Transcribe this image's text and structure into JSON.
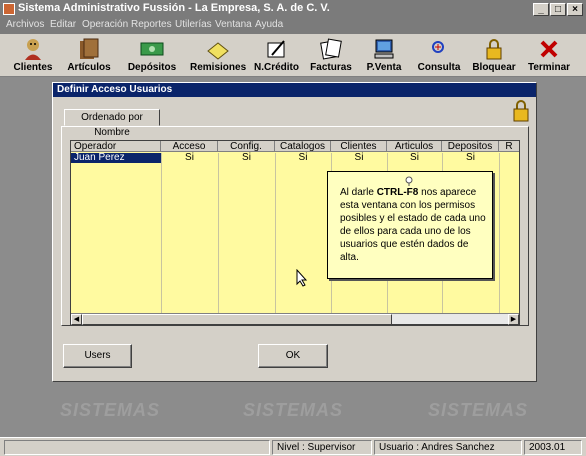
{
  "window": {
    "title": "Sistema Administrativo Fussión - La Empresa, S. A. de C. V."
  },
  "menu": [
    "Archivos",
    "Editar",
    "Operación",
    "Reportes",
    "Utilerías",
    "Ventana",
    "Ayuda"
  ],
  "toolbar": [
    {
      "label": "Clientes",
      "icon": "person-icon"
    },
    {
      "label": "Artículos",
      "icon": "folders-icon"
    },
    {
      "label": "Depósitos",
      "icon": "money-icon"
    },
    {
      "label": "Remisiones",
      "icon": "notepad-icon"
    },
    {
      "label": "N.Crédito",
      "icon": "pen-icon"
    },
    {
      "label": "Facturas",
      "icon": "invoice-icon"
    },
    {
      "label": "P.Venta",
      "icon": "computer-icon"
    },
    {
      "label": "Consulta",
      "icon": "magnifier-icon"
    },
    {
      "label": "Bloquear",
      "icon": "lock-icon"
    },
    {
      "label": "Terminar",
      "icon": "red-x-icon"
    }
  ],
  "watermark": {
    "text": "SISTEMAS"
  },
  "dialog": {
    "title": "Definir Acceso Usuarios",
    "tab": "Ordenado por Nombre",
    "columns": [
      "Operador",
      "Acceso",
      "Config.",
      "Catalogos",
      "Clientes",
      "Articulos",
      "Depositos",
      "R"
    ],
    "rows": [
      [
        "Juan Perez",
        "Si",
        "Si",
        "Si",
        "Si",
        "Si",
        "Si",
        ""
      ]
    ],
    "note": {
      "before": "Al darle ",
      "key": "CTRL-F8",
      "after": " nos aparece esta ventana con los permisos posibles y el estado de cada uno de ellos para cada uno de los usuarios que estén dados de alta."
    },
    "buttons": {
      "users": "Users",
      "ok": "OK"
    }
  },
  "status": {
    "nivel": "Nivel : Supervisor",
    "usuario": "Usuario : Andres Sanchez",
    "version": "2003.01"
  },
  "colors": {
    "grid_bg": "#fffaa0",
    "title_bg": "#0a246a",
    "note_bg": "#ffffc0"
  }
}
